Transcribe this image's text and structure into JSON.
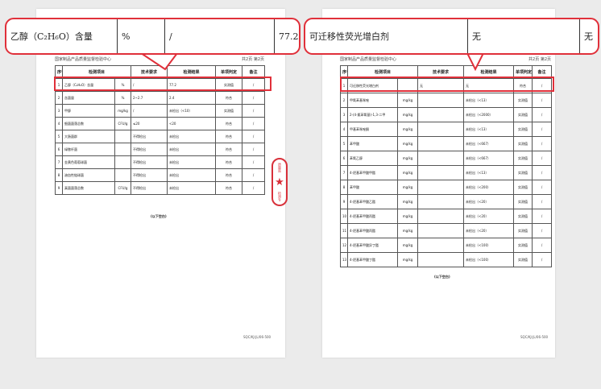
{
  "left_page": {
    "center": "国家制品产品质量监督检验中心",
    "page_no": "共2页 第2页",
    "headers": [
      "序号",
      "检测项目",
      "技术要求",
      "检测结果",
      "单项判定",
      "备注"
    ],
    "rows": [
      {
        "no": "1",
        "item": "乙醇（C₂H₆O）含量",
        "unit": "%",
        "req": "/",
        "result": "77.2",
        "judge": "实测值",
        "note": "/"
      },
      {
        "no": "2",
        "item": "含菌量",
        "unit": "%",
        "req": "2~2.7",
        "result": "2.4",
        "judge": "符合",
        "note": "/"
      },
      {
        "no": "3",
        "item": "甲醇",
        "unit": "mg/kg",
        "req": "/",
        "result": "未检出（<10）",
        "judge": "实测值",
        "note": "/"
      },
      {
        "no": "4",
        "item": "细菌菌落总数",
        "unit": "CFU/g",
        "req": "≤20",
        "result": "<20",
        "judge": "符合",
        "note": "/"
      },
      {
        "no": "5",
        "item": "大肠菌群",
        "unit": "",
        "req": "不得检出",
        "result": "未检出",
        "judge": "符合",
        "note": "/"
      },
      {
        "no": "6",
        "item": "绿脓杆菌",
        "unit": "",
        "req": "不得检出",
        "result": "未检出",
        "judge": "符合",
        "note": "/"
      },
      {
        "no": "7",
        "item": "金黄色葡萄球菌",
        "unit": "",
        "req": "不得检出",
        "result": "未检出",
        "judge": "符合",
        "note": "/"
      },
      {
        "no": "8",
        "item": "溶血性链球菌",
        "unit": "",
        "req": "不得检出",
        "result": "未检出",
        "judge": "符合",
        "note": "/"
      },
      {
        "no": "9",
        "item": "真菌菌落总数",
        "unit": "CFU/g",
        "req": "不得检出",
        "result": "未检出",
        "judge": "符合",
        "note": "/"
      }
    ],
    "end_mark": "(以下空白)",
    "doc_no": "SQC/KJ-JL/06-500"
  },
  "right_page": {
    "center": "国家制品产品质量监督检验中心",
    "page_no": "共2页 第2页",
    "headers": [
      "序号",
      "检测项目",
      "技术要求",
      "检测结果",
      "单项判定",
      "备注"
    ],
    "rows": [
      {
        "no": "1",
        "item": "可迁移性荧光增白剂",
        "unit": "",
        "req": "无",
        "result": "无",
        "judge": "符合",
        "note": "/"
      },
      {
        "no": "2",
        "item": "甲氧苯基咪唑",
        "unit": "mg/kg",
        "req": "",
        "result": "未检出（<13）",
        "judge": "实测值",
        "note": "/"
      },
      {
        "no": "3",
        "item": "2-(4-氯苯氧基)-1,3-二甲",
        "unit": "mg/kg",
        "req": "",
        "result": "未检出（<2000）",
        "judge": "实测值",
        "note": "/"
      },
      {
        "no": "4",
        "item": "甲基苯咪唑酮",
        "unit": "mg/kg",
        "req": "",
        "result": "未检出（<13）",
        "judge": "实测值",
        "note": "/"
      },
      {
        "no": "5",
        "item": "苯甲酸",
        "unit": "mg/kg",
        "req": "",
        "result": "未检出（<667）",
        "judge": "实测值",
        "note": "/"
      },
      {
        "no": "6",
        "item": "苯氧乙醇",
        "unit": "mg/kg",
        "req": "",
        "result": "未检出（<667）",
        "judge": "实测值",
        "note": "/"
      },
      {
        "no": "7",
        "item": "4-羟基苯甲酸甲酯",
        "unit": "mg/kg",
        "req": "",
        "result": "未检出（<13）",
        "judge": "实测值",
        "note": "/"
      },
      {
        "no": "8",
        "item": "苯甲酸",
        "unit": "mg/kg",
        "req": "",
        "result": "未检出（<200）",
        "judge": "实测值",
        "note": "/"
      },
      {
        "no": "9",
        "item": "4-羟基苯甲酸乙酯",
        "unit": "mg/kg",
        "req": "",
        "result": "未检出（<20）",
        "judge": "实测值",
        "note": "/"
      },
      {
        "no": "10",
        "item": "4-羟基苯甲酸丙酯",
        "unit": "mg/kg",
        "req": "",
        "result": "未检出（<20）",
        "judge": "实测值",
        "note": "/"
      },
      {
        "no": "11",
        "item": "4-羟基苯甲酸丙酯",
        "unit": "mg/kg",
        "req": "",
        "result": "未检出（<20）",
        "judge": "实测值",
        "note": "/"
      },
      {
        "no": "12",
        "item": "4-羟基苯甲酸异丁酯",
        "unit": "mg/kg",
        "req": "",
        "result": "未检出（<100）",
        "judge": "实测值",
        "note": "/"
      },
      {
        "no": "13",
        "item": "4-羟基苯甲酸丁酯",
        "unit": "mg/kg",
        "req": "",
        "result": "未检出（<100）",
        "judge": "实测值",
        "note": "/"
      }
    ],
    "end_mark": "(以下空白)",
    "doc_no": "SQC/KJ-JL/06-500"
  },
  "callout_left": {
    "item": "乙醇（C₂H₆O）含量",
    "unit": "%",
    "req": "/",
    "result": "77.2"
  },
  "callout_right": {
    "item": "可迁移性荧光增白剂",
    "req": "无",
    "result": "无"
  },
  "stamp": {
    "top": "质量监",
    "bottom": "检测专"
  },
  "colors": {
    "highlight": "#e0303a",
    "stamp": "#d8303a"
  }
}
